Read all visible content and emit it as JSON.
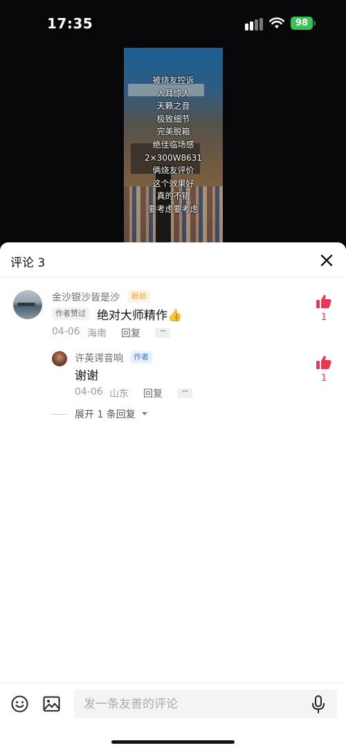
{
  "status_bar": {
    "time": "17:35",
    "battery": "98"
  },
  "video": {
    "overlay_lines": [
      "被烧友控诉",
      "入耳惊人",
      "天籁之音",
      "极致细节",
      "完美脱箱",
      "绝佳临场感",
      "2×300W8631",
      "俩烧友评价",
      "这个效果好",
      "真的不错",
      "要考虑要考虑"
    ]
  },
  "sheet": {
    "title": "评论 3"
  },
  "comments": [
    {
      "user": "金沙银沙皆是沙",
      "badge": "粉丝",
      "tag": "作者赞过",
      "text": "绝对大师精作👍",
      "date": "04-06",
      "location": "海南",
      "reply_label": "回复",
      "more": "···",
      "likes": "1"
    },
    {
      "user": "许英谔音响",
      "badge": "作者",
      "text": "谢谢",
      "date": "04-06",
      "location": "山东",
      "reply_label": "回复",
      "more": "···",
      "likes": "1"
    }
  ],
  "expand_replies": "展开 1 条回复",
  "input": {
    "placeholder": "发一条友善的评论"
  },
  "colors": {
    "like_red": "#e53b52",
    "fan_badge": "#e7a23b",
    "author_badge": "#3a78e7",
    "battery_green": "#3cc159"
  },
  "icons": [
    "signal-icon",
    "wifi-icon",
    "battery-icon",
    "close-icon",
    "thumbs-up-icon",
    "emoji-icon",
    "image-icon",
    "mic-icon",
    "chevron-down-icon"
  ]
}
